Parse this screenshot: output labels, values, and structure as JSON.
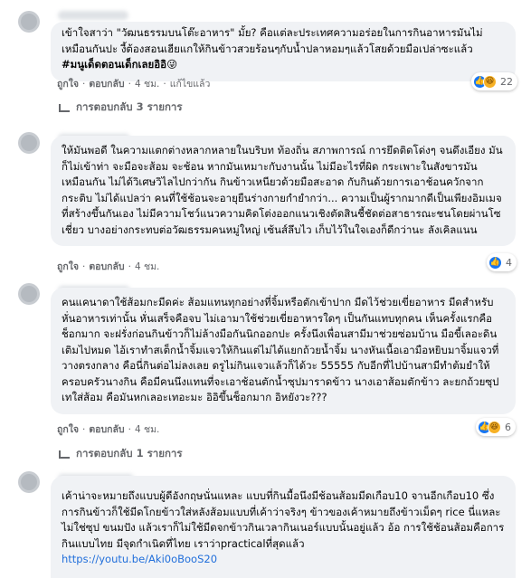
{
  "comments": [
    {
      "text": "เข้าใจสาว่า \"วัฒนธรรมบนโต๊ะอาหาร\" มั้ย? คือแต่ละประเทศความอร่อยในการกินอาหารมันไม่เหมือนกันปะ งี้ต้องสอนเฮียแกให้กินข้าวสวยร้อนๆกับน้ำปลาหอมๆแล้วโสยด้วยมือเปล่าซะแล้ว",
      "hashtag": "#มนูเด็ดตอนเด็กเลยอิอิ",
      "emoji": "😜",
      "like": "ถูกใจ",
      "reply": "ตอบกลับ",
      "time": "4 ชม.",
      "edited": "แก้ไขแล้ว",
      "reaction_count": "22",
      "replies_label": "การตอบกลับ 3 รายการ"
    },
    {
      "text": "ให้มันพอดี ในความแตกต่างหลากหลายในบริบท ท้องถิ่น สภาพการณ์ การยึดติดโด่งๆ จนดึงเอียง มันก็ไม่เข้าท่า จะมือจะส้อม จะช้อน หากมันเหมาะกับงานนั้น ไม่มีอะไรที่ผิด กระเพาะในสังขารมันเหมือนกัน ไม่ได้วิเศษวิไลไปกว่ากัน กินข้าวเหนียวด้วยมือสะอาด กับกินด้วยการเอาช้อนควักจากกระติบ ไม่ได้แปลว่า คนที่ใช้ช้อนจะอายุยืนร่างกายกำยำกว่า... ความเป็นผู้รากมากดีเป็นเพียงอิมเมจที่สร้างขึ้นกันเอง ไม่มีความโชว์แนวความคิดโต่งออกแนวเชิงตัดสินชี้ชัดต่อสาธารณะชนโดยผ่านโซเชี่ยว บางอย่างกระทบต่อวัฒธรรมคนหมู่ใหญ่ เซ้นส์ลึบไว เก็บไว้ในใจเองก็ดีกว่านะ ลังเคิลแนน",
      "like": "ถูกใจ",
      "reply": "ตอบกลับ",
      "time": "4 ชม.",
      "reaction_count": "4"
    },
    {
      "text": "คนแคนาดาใช้ส้อมกะมีดค่ะ ส้อมแทนทุกอย่างที่จิ้มหรือตักเข้าปาก มีดไว้ช่วยเขี่ยอาหาร มีดสำหรับหั่นอาหารเท่านั้น หั่นเสร็จคือจบ ไม่เอามาใช้ช่วยเขี่ยอาหารใดๆ เป็นกันแทบทุกคน เห็นครั้งแรกคือช็อกมาก จะฝรั่งก่อนกินข้าวก็ไม่ล้างมือกันนิกออกปะ ครั้งนึงเพื่อนสามีมาช่วยซ่อมบ้าน มือขี้เลอะดินเติมไปหมด ไอ้เราทำสเต็กน้ำจิ้มแจวให้กินแต่ไม่ได้แยกถ้วยน้ำจิ้ม นางหันเนื้อเอามือหยิบมาจิ้มแจวที่วางตรงกลาง คือนี่กินต่อไม่ลงเลย ดรูไม่กินแจวแล้วก็ได้วะ 55555 กับอีกที่ไปบ้านสามีทำต้มยำให้ครอบครัวนางกิน คือมีคนนึงแทนที่จะเอาช้อนตักน้ำซุปมาราดข้าว นางเอาส้อมตักข้าว ละยกถ้วยซุปเทใส่ส้อม คือมันหกเลอะเทอะมะ อิอิขึ้นช็อกมาก อิหยังวะ???",
      "like": "ถูกใจ",
      "reply": "ตอบกลับ",
      "time": "4 ชม.",
      "reaction_count": "6",
      "replies_label": "การตอบกลับ 1 รายการ"
    },
    {
      "text": "เค้าน่าจะหมายถึงแบบผู้ดีอังกฤษนั่นแหละ แบบที่กินมื้อนึงมีช้อนส้อมมีดเกือบ10 จานอีกเกือบ10 ซึ่งการกินข้าวก็ใช้มีดโกยข้าวใส่หลังส้อมแบบที่เค้าว่าจริงๆ ข้าวของเค้าหมายถึงข้าวเม็ดๆ rice นี่แหละ ไม่ใช่ซุป ขนมปัง แล้วเราก็ไม่ใช้มีดจกข้าวกินเวลากินเนอร์แบบนั้นอยู่แล้ว อ้อ การใช้ช้อนส้อมคือการกินแบบไทย มีจุดกำเนิดที่ไทย เราว่าpracticalที่สุดแล้ว",
      "link": "https://youtu.be/Aki0oBooS20"
    }
  ],
  "colors": {
    "bubble": "#f0f2f5",
    "meta": "#65676b",
    "link": "#216fdb",
    "like_blue": "#1877f2",
    "haha_yellow": "#f7b125"
  },
  "icons": [
    "avatar",
    "like-icon",
    "haha-icon",
    "reply-arrow-icon"
  ]
}
